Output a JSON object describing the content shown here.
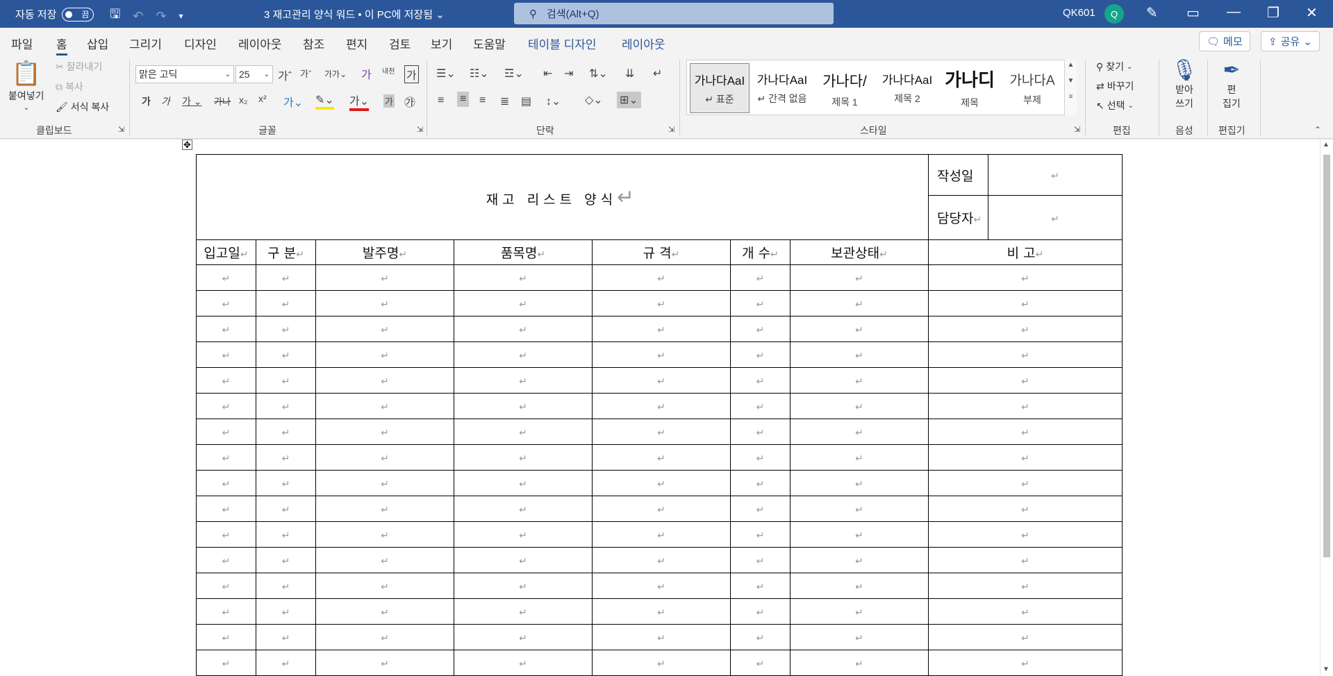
{
  "titlebar": {
    "autosave_label": "자동 저장",
    "autosave_state": "끔",
    "doc_title": "3 재고관리 양식 워드 • 이 PC에 저장됨",
    "search_placeholder": "검색(Alt+Q)",
    "user": "QK601",
    "avatar_initial": "Q"
  },
  "tabs": [
    "파일",
    "홈",
    "삽입",
    "그리기",
    "디자인",
    "레이아웃",
    "참조",
    "편지",
    "검토",
    "보기",
    "도움말",
    "테이블 디자인",
    "레이아웃"
  ],
  "tab_buttons": {
    "memo": "메모",
    "share": "공유"
  },
  "ribbon": {
    "clipboard": {
      "paste": "붙여넣기",
      "cut": "잘라내기",
      "copy": "복사",
      "format_painter": "서식 복사",
      "label": "클립보드"
    },
    "font": {
      "name": "맑은 고딕",
      "size": "25",
      "label": "글꼴"
    },
    "paragraph": {
      "label": "단락"
    },
    "styles": {
      "label": "스타일",
      "items": [
        {
          "sample": "가나다AaI",
          "name": "↵ 표준"
        },
        {
          "sample": "가나다AaI",
          "name": "↵ 간격 없음"
        },
        {
          "sample": "가나다/",
          "name": "제목 1"
        },
        {
          "sample": "가나다AaI",
          "name": "제목 2"
        },
        {
          "sample": "가나디",
          "name": "제목"
        },
        {
          "sample": "가나다A",
          "name": "부제"
        }
      ]
    },
    "editing": {
      "find": "찾기",
      "replace": "바꾸기",
      "select": "선택",
      "label": "편집"
    },
    "voice": {
      "dictate_1": "받아",
      "dictate_2": "쓰기",
      "label": "음성"
    },
    "editor": {
      "editor_1": "편",
      "editor_2": "집기",
      "label": "편집기"
    }
  },
  "document": {
    "title": "재고 리스트 양식",
    "meta": {
      "date_label": "작성일",
      "manager_label": "담당자"
    },
    "columns": [
      "입고일",
      "구 분",
      "발주명",
      "품목명",
      "규 격",
      "개 수",
      "보관상태",
      "비 고"
    ],
    "para_mark": "↵"
  },
  "colors": {
    "accent": "#2b579a",
    "titlebar": "#2b579a"
  }
}
